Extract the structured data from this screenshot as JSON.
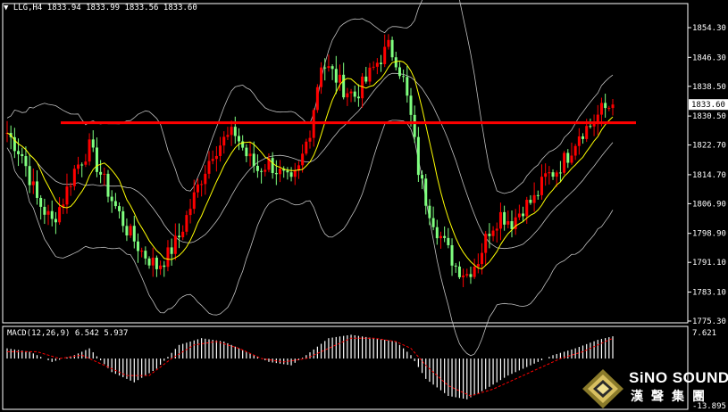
{
  "header": {
    "arrow": "▼",
    "symbol": "LLG,H4",
    "ohlc": "1833.94 1833.99 1833.56 1833.60"
  },
  "macd_header": "MACD(12,26,9) 6.542 5.937",
  "colors": {
    "background": "#000000",
    "bull": "#ff0000",
    "bear": "#7fff7f",
    "resistance": "#ff0000",
    "ma": "#ffff00",
    "bands": "#c0c0c0",
    "signal": "#ff0000",
    "histogram": "#ffffff"
  },
  "chart_data": [
    {
      "type": "candlestick",
      "symbol": "LLG",
      "timeframe": "H4",
      "ylim": [
        1775.3,
        1858.0
      ],
      "y_ticks": [
        "1854.30",
        "1846.30",
        "1838.50",
        "1830.50",
        "1822.70",
        "1814.70",
        "1806.90",
        "1798.90",
        "1791.10",
        "1783.10",
        "1775.30"
      ],
      "last_price": "1833.60",
      "resistance_level": 1828.7,
      "close_path": [
        [
          0,
          1826
        ],
        [
          4,
          1820
        ],
        [
          8,
          1808
        ],
        [
          12,
          1802
        ],
        [
          15,
          1808
        ],
        [
          18,
          1816
        ],
        [
          22,
          1822
        ],
        [
          25,
          1815
        ],
        [
          28,
          1808
        ],
        [
          32,
          1800
        ],
        [
          36,
          1794
        ],
        [
          40,
          1790
        ],
        [
          43,
          1793
        ],
        [
          46,
          1798
        ],
        [
          49,
          1806
        ],
        [
          52,
          1814
        ],
        [
          55,
          1821
        ],
        [
          58,
          1824
        ],
        [
          61,
          1826
        ],
        [
          64,
          1820
        ],
        [
          67,
          1816
        ],
        [
          70,
          1818
        ],
        [
          73,
          1815
        ],
        [
          76,
          1812
        ],
        [
          78,
          1816
        ],
        [
          81,
          1827
        ],
        [
          84,
          1845
        ],
        [
          87,
          1842
        ],
        [
          90,
          1838
        ],
        [
          93,
          1836
        ],
        [
          96,
          1840
        ],
        [
          99,
          1845
        ],
        [
          102,
          1849
        ],
        [
          104,
          1846
        ],
        [
          106,
          1840
        ],
        [
          108,
          1830
        ],
        [
          110,
          1816
        ],
        [
          112,
          1808
        ],
        [
          115,
          1800
        ],
        [
          118,
          1794
        ],
        [
          120,
          1790
        ],
        [
          123,
          1788
        ],
        [
          126,
          1792
        ],
        [
          129,
          1800
        ],
        [
          132,
          1804
        ],
        [
          135,
          1802
        ],
        [
          138,
          1806
        ],
        [
          141,
          1808
        ],
        [
          144,
          1814
        ],
        [
          147,
          1816
        ],
        [
          150,
          1820
        ],
        [
          153,
          1826
        ],
        [
          156,
          1828
        ],
        [
          159,
          1832
        ],
        [
          162,
          1833.6
        ]
      ],
      "n_bars": 163
    },
    {
      "type": "bar",
      "indicator": "MACD(12,26,9)",
      "y_ticks": [
        "7.621",
        "-13.895"
      ],
      "ylim": [
        -13.895,
        7.621
      ],
      "macd_path": [
        [
          0,
          3
        ],
        [
          6,
          2
        ],
        [
          12,
          -1
        ],
        [
          18,
          1
        ],
        [
          22,
          3
        ],
        [
          28,
          -4
        ],
        [
          34,
          -7
        ],
        [
          40,
          -3
        ],
        [
          46,
          4
        ],
        [
          52,
          6
        ],
        [
          58,
          5
        ],
        [
          64,
          2
        ],
        [
          70,
          -1
        ],
        [
          76,
          -2
        ],
        [
          80,
          1
        ],
        [
          86,
          6
        ],
        [
          92,
          7
        ],
        [
          98,
          6
        ],
        [
          104,
          5
        ],
        [
          108,
          1
        ],
        [
          112,
          -6
        ],
        [
          118,
          -11
        ],
        [
          123,
          -12
        ],
        [
          128,
          -9
        ],
        [
          134,
          -5
        ],
        [
          140,
          -2
        ],
        [
          146,
          1
        ],
        [
          152,
          3
        ],
        [
          158,
          5.5
        ],
        [
          162,
          6.542
        ]
      ],
      "signal_path": [
        [
          0,
          2
        ],
        [
          8,
          2
        ],
        [
          14,
          0
        ],
        [
          20,
          1
        ],
        [
          26,
          -2
        ],
        [
          32,
          -5
        ],
        [
          38,
          -5
        ],
        [
          44,
          0
        ],
        [
          50,
          4
        ],
        [
          56,
          5
        ],
        [
          62,
          3
        ],
        [
          68,
          0
        ],
        [
          74,
          -1
        ],
        [
          80,
          0
        ],
        [
          86,
          3
        ],
        [
          92,
          6
        ],
        [
          98,
          6
        ],
        [
          104,
          5
        ],
        [
          108,
          3
        ],
        [
          112,
          -2
        ],
        [
          118,
          -8
        ],
        [
          124,
          -11
        ],
        [
          130,
          -9
        ],
        [
          136,
          -6
        ],
        [
          142,
          -3
        ],
        [
          148,
          0
        ],
        [
          154,
          2
        ],
        [
          160,
          5
        ],
        [
          162,
          5.937
        ]
      ]
    }
  ],
  "logo": {
    "english": "SiNO SOUND",
    "chinese": "漢聲集團"
  }
}
